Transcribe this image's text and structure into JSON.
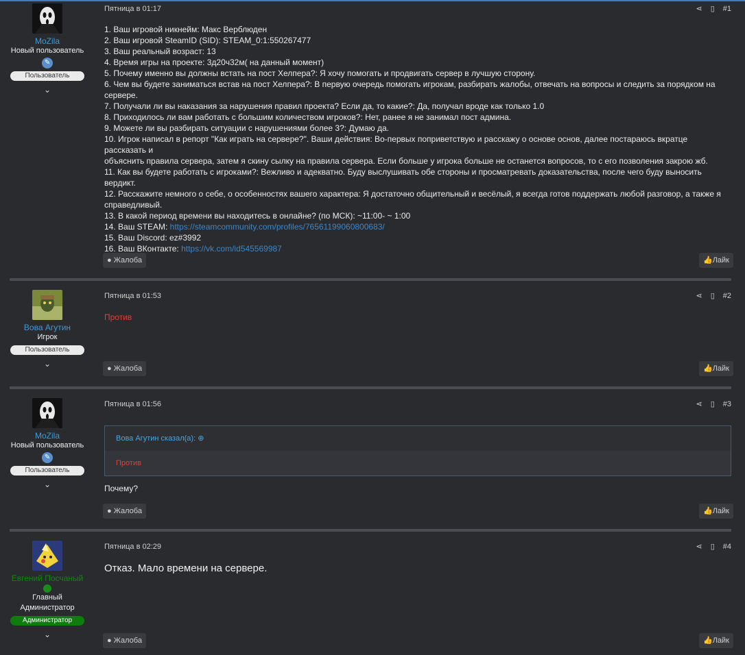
{
  "posts": [
    {
      "username": "MoZila",
      "user_title": "Новый пользователь",
      "role": "Пользователь",
      "date": "Пятница в 01:17",
      "number": "#1",
      "lines": [
        "1. Ваш игровой никнейм: Макс Верблюден",
        "2. Ваш игровой SteamID (SID): STEAM_0:1:550267477",
        "3. Ваш реальный возраст: 13",
        "4. Время игры на проекте: 3д20ч32м( на данный момент)",
        "5. Почему именно вы должны встать на пост Хелпера?: Я хочу помогать и продвигать сервер в лучшую сторону.",
        "6. Чем вы будете заниматься встав на пост Хелпера?: В первую очередь помогать игрокам, разбирать жалобы, отвечать на вопросы и следить за порядком на",
        "сервере.",
        "7. Получали ли вы наказания за нарушения правил проекта? Если да, то какие?: Да, получал вроде как только 1.0",
        "8. Приходилось ли вам работать с большим количеством игроков?: Нет, ранее я не занимал пост админа.",
        "9. Можете ли вы разбирать ситуации с нарушениями более 3?: Думаю да.",
        "10. Игрок написал в репорт \"Как играть на сервере?\". Ваши действия: Во-первых поприветствую и расскажу о основе основ, далее постараюсь вкратце рассказать и",
        "объяснить правила сервера, затем я скину сылку на правила сервера. Если больше у игрока больше не останется вопросов, то с его позволения закрою жб.",
        "11. Как вы будете работать с игроками?: Вежливо и адекватно. Буду выслушивать обе стороны и просматревать доказательства, после чего буду выносить",
        "вердикт.",
        "12. Расскажите немного о себе, о особенностях вашего характера: Я достаточно общительный и весёлый, я всегда готов поддержать любой разговор, а также я",
        "справедливый.",
        "13. В какой период времени вы находитесь в онлайне? (по МСК): ~11:00- ~ 1:00"
      ],
      "steam_label": "14. Ваш STEAM: ",
      "steam_link": "https://steamcommunity.com/profiles/76561199060800683/",
      "discord": "15. Ваш Discord: ez#3992",
      "vk_label": "16. Ваш ВКонтакте: ",
      "vk_link": "https://vk.com/id545569987"
    },
    {
      "username": "Вова Агутин",
      "user_title": "Игрок",
      "role": "Пользователь",
      "date": "Пятница в 01:53",
      "number": "#2",
      "text": "Против"
    },
    {
      "username": "MoZila",
      "user_title": "Новый пользователь",
      "role": "Пользователь",
      "date": "Пятница в 01:56",
      "number": "#3",
      "quote_author": "Вова Агутин сказал(а):",
      "quote_text": "Против",
      "text": "Почему?"
    },
    {
      "username": "Евгений Посчаный",
      "user_title_1": "Главный",
      "user_title_2": "Администратор",
      "role": "Администратор",
      "date": "Пятница в 02:29",
      "number": "#4",
      "text": "Отказ. Мало времени на сервере."
    }
  ],
  "buttons": {
    "report": "Жалоба",
    "like": "Лайк"
  },
  "icons": {
    "share": "share-icon",
    "bookmark": "bookmark-icon",
    "chevron": "chevron-down-icon",
    "report": "info-icon",
    "like": "thumbs-up-icon",
    "quote_arrow": "arrow-up-circle-icon"
  },
  "colors": {
    "accent": "#3d9ad6",
    "admin": "#0e7d0e",
    "against": "#d9403c",
    "link": "#3d86c6"
  }
}
